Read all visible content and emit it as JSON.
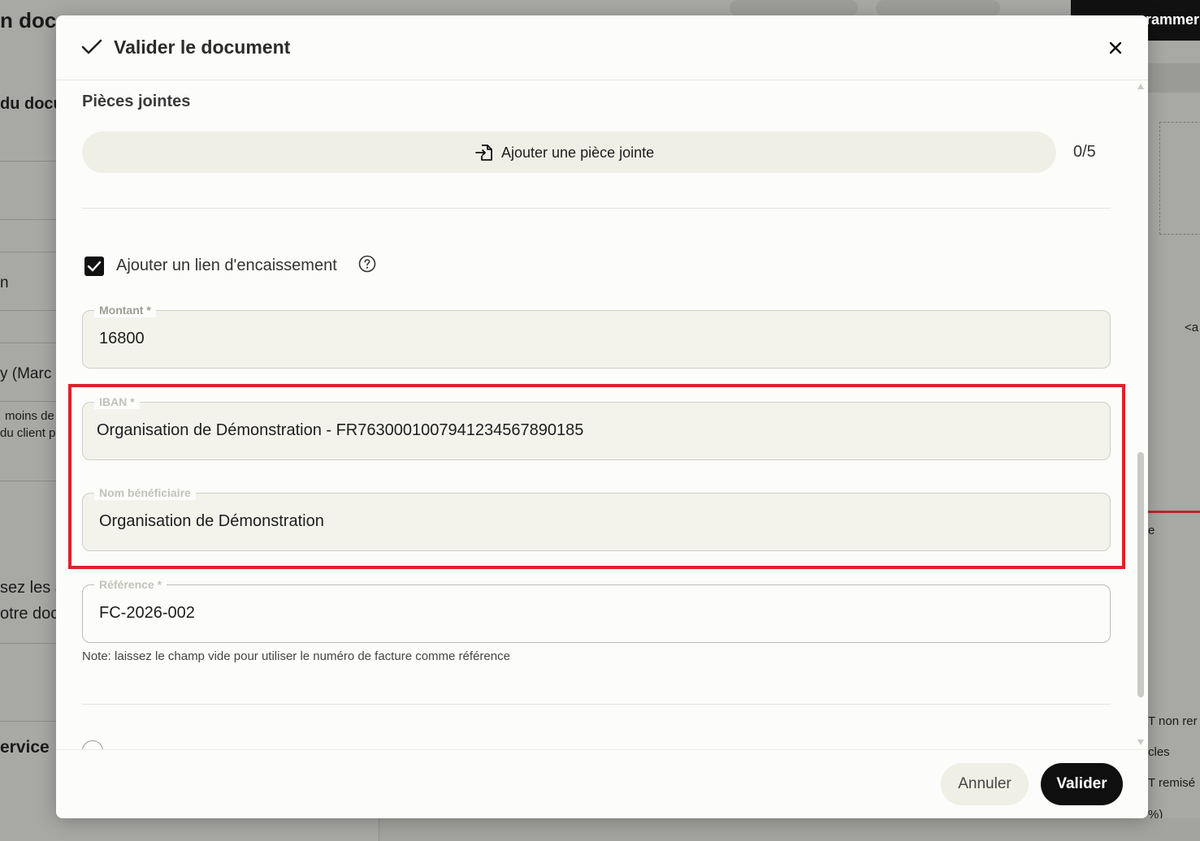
{
  "background": {
    "left_texts": [
      {
        "name": "bg-title-fragment",
        "text": "n doc"
      },
      {
        "name": "bg-heading-fragment",
        "text": "du docu"
      },
      {
        "name": "bg-text-n",
        "text": "n"
      },
      {
        "name": "bg-text-marc",
        "text": "y (Marc"
      },
      {
        "name": "bg-text-moins",
        "text": "moins de"
      },
      {
        "name": "bg-text-client",
        "text": "du client p"
      },
      {
        "name": "bg-text-sez",
        "text": "sez les a"
      },
      {
        "name": "bg-text-otre",
        "text": "otre doc"
      },
      {
        "name": "bg-text-service",
        "text": "ervice"
      }
    ],
    "right_texts": [
      {
        "name": "bg-text-a",
        "text": "<a"
      },
      {
        "name": "bg-text-e",
        "text": "e"
      },
      {
        "name": "bg-text-nonrem",
        "text": "T non rer"
      },
      {
        "name": "bg-text-cles",
        "text": "cles"
      },
      {
        "name": "bg-text-remise",
        "text": "T remisé"
      },
      {
        "name": "bg-text-pct",
        "text": "%)"
      }
    ],
    "program_button": "rammer"
  },
  "modal": {
    "title": "Valider le document",
    "attachments": {
      "section_title": "Pièces jointes",
      "add_label": "Ajouter une pièce jointe",
      "count": "0/5"
    },
    "payment_link": {
      "checkbox_label": "Ajouter un lien d'encaissement",
      "checked": true
    },
    "fields": {
      "amount": {
        "label": "Montant *",
        "value": "16800"
      },
      "iban": {
        "label": "IBAN *",
        "value": "Organisation de Démonstration - FR7630001007941234567890185"
      },
      "beneficiary": {
        "label": "Nom bénéficiaire",
        "value": "Organisation de Démonstration"
      },
      "reference": {
        "label": "Référence *",
        "value": "FC-2026-002"
      }
    },
    "note": "Note: laissez le champ vide pour utiliser le numéro de facture comme référence",
    "footer": {
      "cancel_label": "Annuler",
      "validate_label": "Valider"
    }
  },
  "colors": {
    "accent": "#0f0f0f",
    "highlight": "#e0222b",
    "field_bg": "#f3f3ec"
  }
}
